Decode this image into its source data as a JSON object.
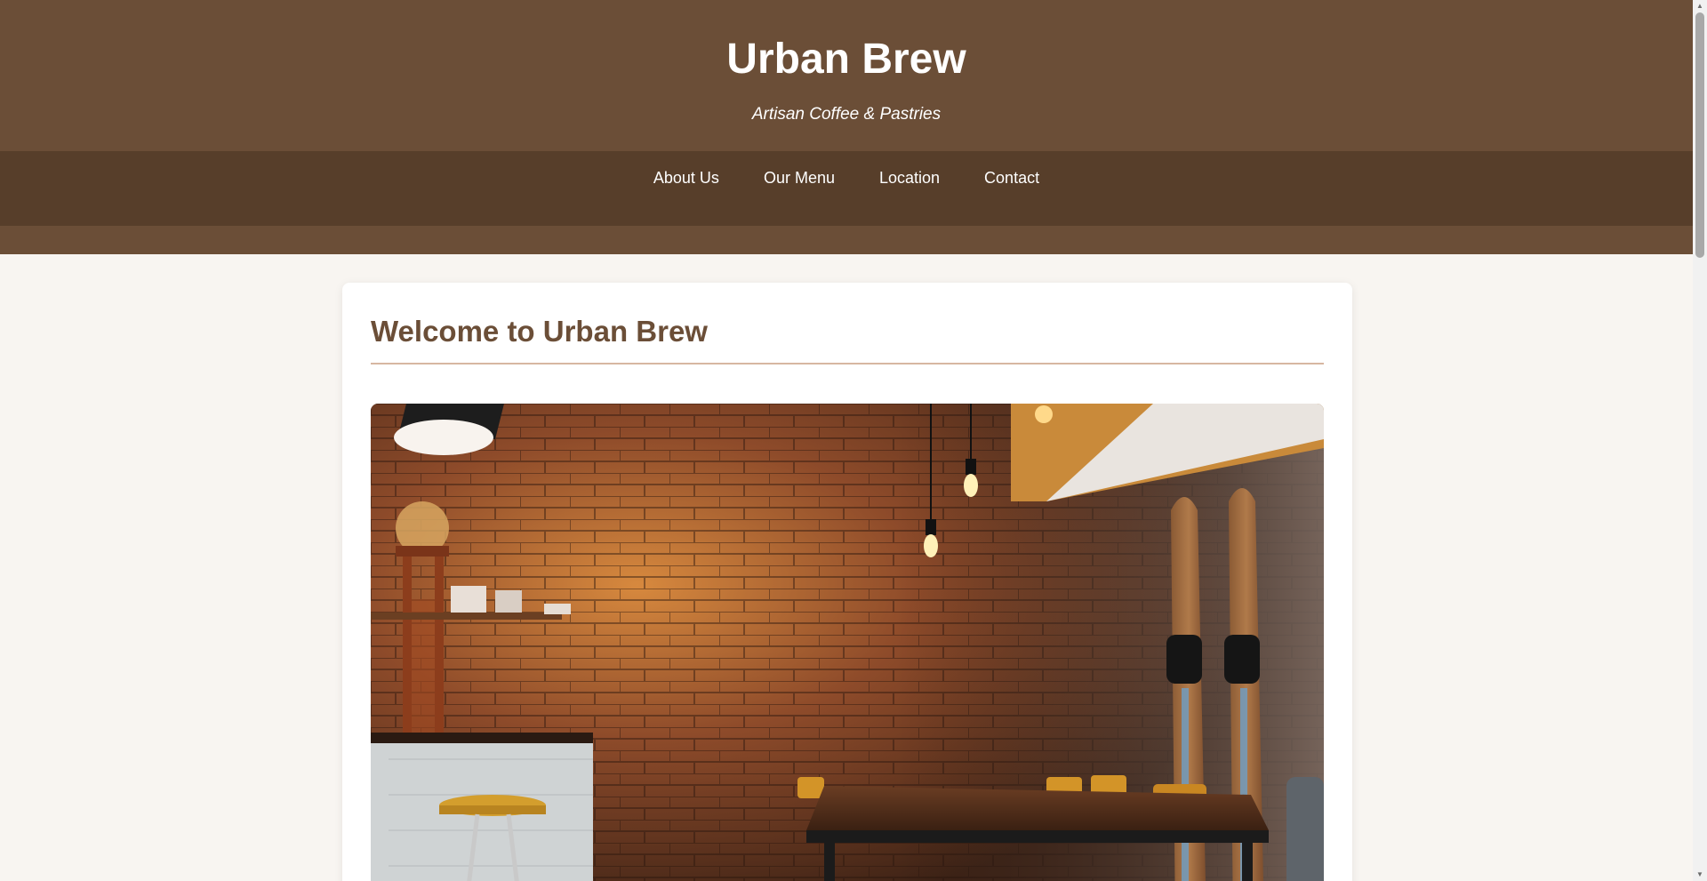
{
  "header": {
    "title": "Urban Brew",
    "tagline": "Artisan Coffee & Pastries"
  },
  "nav": {
    "items": [
      {
        "label": "About Us"
      },
      {
        "label": "Our Menu"
      },
      {
        "label": "Location"
      },
      {
        "label": "Contact"
      }
    ]
  },
  "main": {
    "heading": "Welcome to Urban Brew",
    "hero_image_alt": "cafe interior photo"
  },
  "scrollbar": {
    "up_icon": "triangle-up-icon",
    "down_icon": "triangle-down-icon"
  },
  "colors": {
    "header_bg": "#6b4e37",
    "nav_bg": "#573e2a",
    "page_bg": "#f8f5f1",
    "heading": "#6b4e37",
    "divider": "#d7b7a1"
  }
}
